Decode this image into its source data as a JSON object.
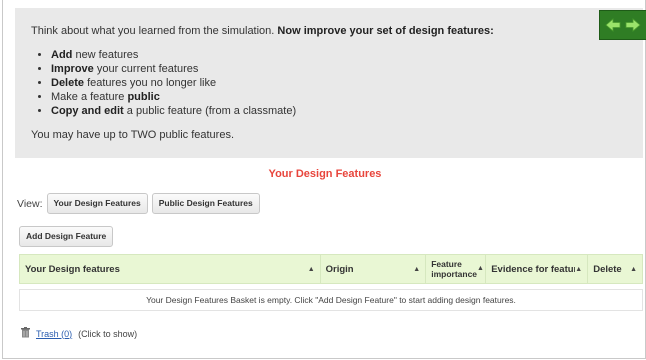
{
  "instructions": {
    "intro_plain": "Think about what you learned from the simulation. ",
    "intro_bold": "Now improve your set of design features:",
    "bullets": [
      {
        "bold": "Add",
        "rest": " new features"
      },
      {
        "bold": "Improve",
        "rest": " your current features"
      },
      {
        "bold": "Delete",
        "rest": " features you no longer like"
      },
      {
        "bold": "public",
        "prefix": "Make a feature ",
        "rest": ""
      },
      {
        "bold": "Copy and edit",
        "rest": " a public feature (from a classmate)"
      }
    ],
    "note": "You may have up to TWO public features."
  },
  "nav": {
    "back_icon": "left-arrow",
    "forward_icon": "right-arrow",
    "color": "#2f7d24"
  },
  "section_title": "Your Design Features",
  "view": {
    "label": "View:",
    "buttons": [
      "Your Design Features",
      "Public Design Features"
    ]
  },
  "add_button": "Add Design Feature",
  "table": {
    "columns": [
      "Your Design features",
      "Origin",
      "Feature importance",
      "Evidence for feature",
      "Delete"
    ],
    "empty_message": "Your Design Features Basket is empty. Click \"Add Design Feature\" to start adding design features."
  },
  "trash": {
    "link": "Trash (0)",
    "hint": "(Click to show)"
  },
  "colors": {
    "title": "#e8453c",
    "header_bg": "#e9f7d4",
    "panel_bg": "#e9e9e9"
  }
}
